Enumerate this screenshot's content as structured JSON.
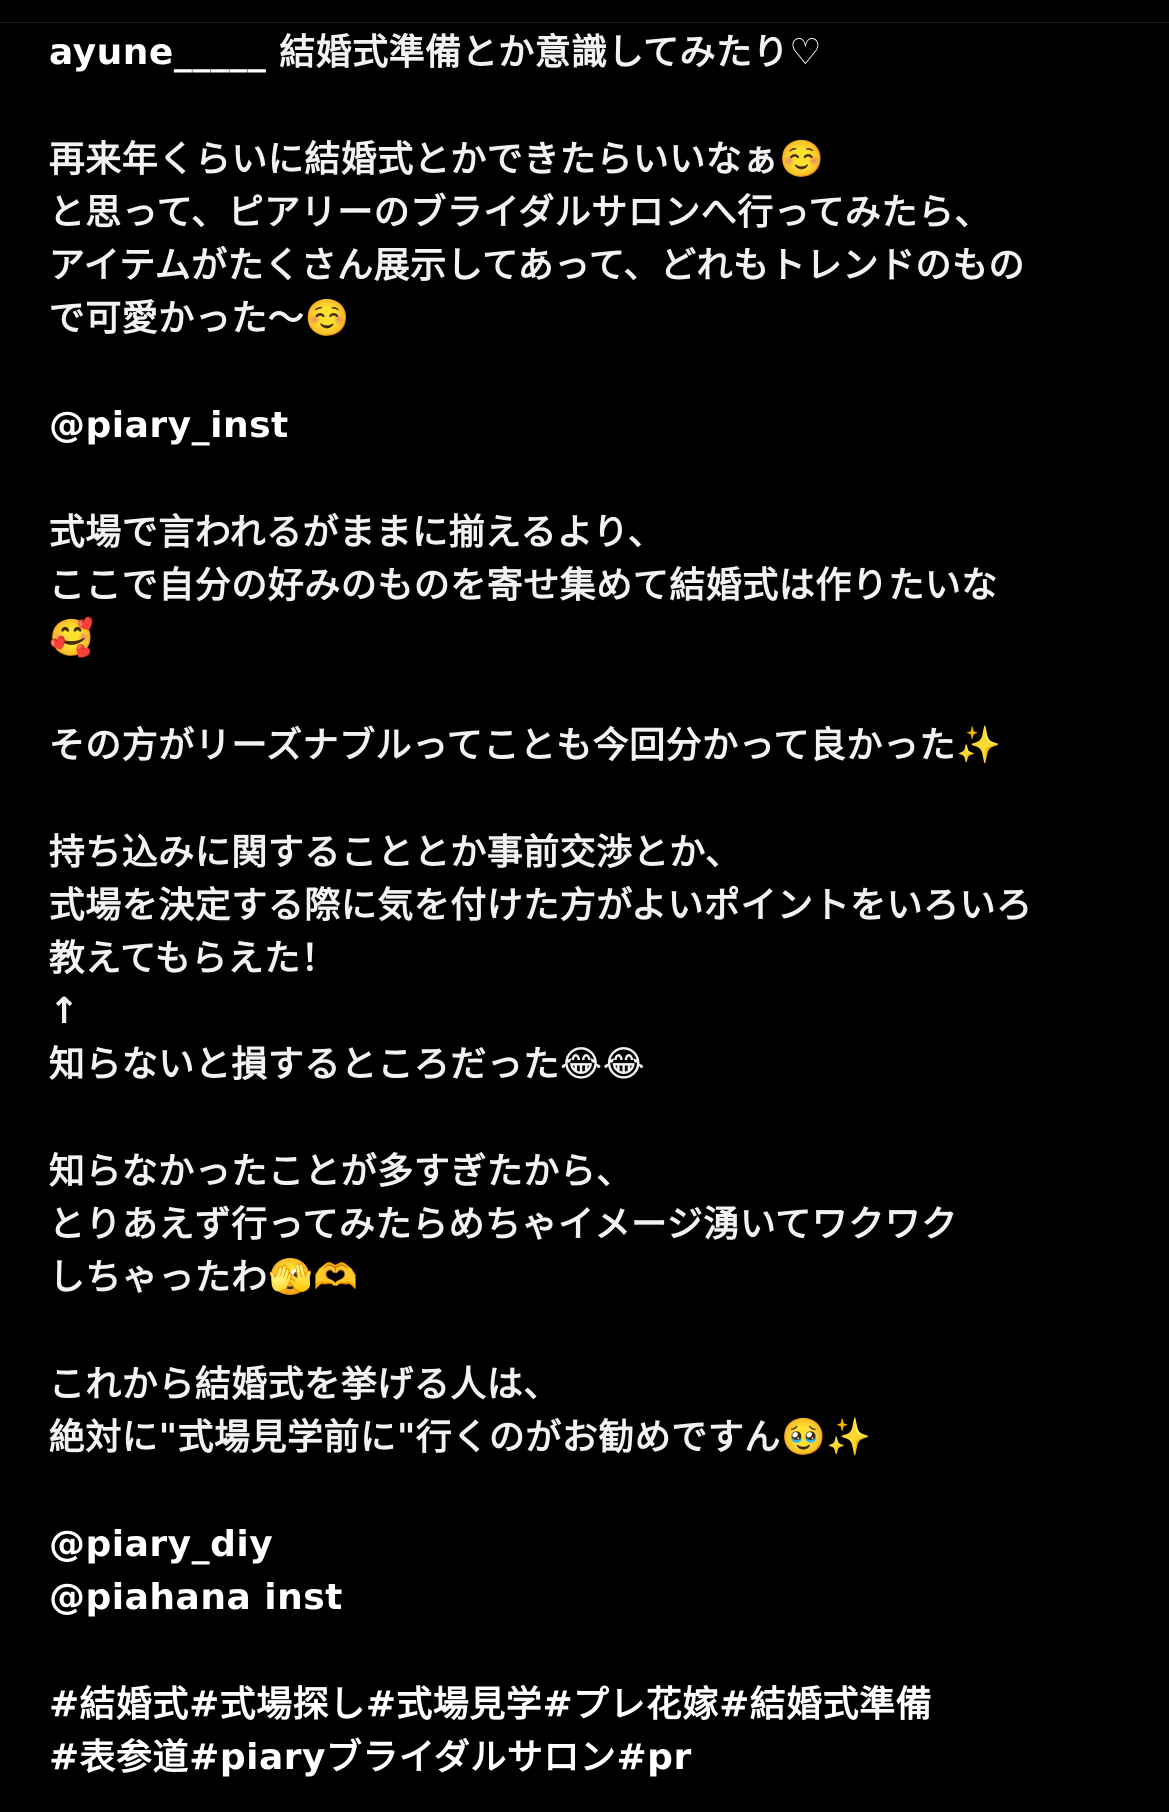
{
  "post": {
    "username": "ayune_____",
    "first_line": " 結婚式準備とか意識してみたり♡",
    "para1": [
      "再来年くらいに結婚式とかできたらいいなぁ☺️",
      "と思って、ピアリーのブライダルサロンへ行ってみたら、",
      "アイテムがたくさん展示してあって、どれもトレンドのもの",
      "で可愛かった〜☺️"
    ],
    "mention1": "@piary_inst",
    "para2": [
      "式場で言われるがままに揃えるより、",
      "ここで自分の好みのものを寄せ集めて結婚式は作りたいな",
      "🥰"
    ],
    "para3": [
      "その方がリーズナブルってことも今回分かって良かった✨"
    ],
    "para4": [
      "持ち込みに関することとか事前交渉とか、",
      "式場を決定する際に気を付けた方がよいポイントをいろいろ",
      "教えてもらえた！",
      "↑",
      "知らないと損するところだった😂😂"
    ],
    "para5": [
      "知らなかったことが多すぎたから、",
      "とりあえず行ってみたらめちゃイメージ湧いてワクワク",
      "しちゃったわ🫣🫶"
    ],
    "para6": [
      "これから結婚式を挙げる人は、",
      "絶対に\"式場見学前に\"行くのがお勧めですん🥹✨"
    ],
    "mention2": "@piary_diy",
    "mention3": "@piahana inst",
    "hashtags": [
      "#結婚式#式場探し#式場見学#プレ花嫁#結婚式準備",
      "#表参道#piaryブライダルサロン#pr"
    ]
  },
  "colors": {
    "background": "#000000",
    "text": "#f2f2f2"
  }
}
